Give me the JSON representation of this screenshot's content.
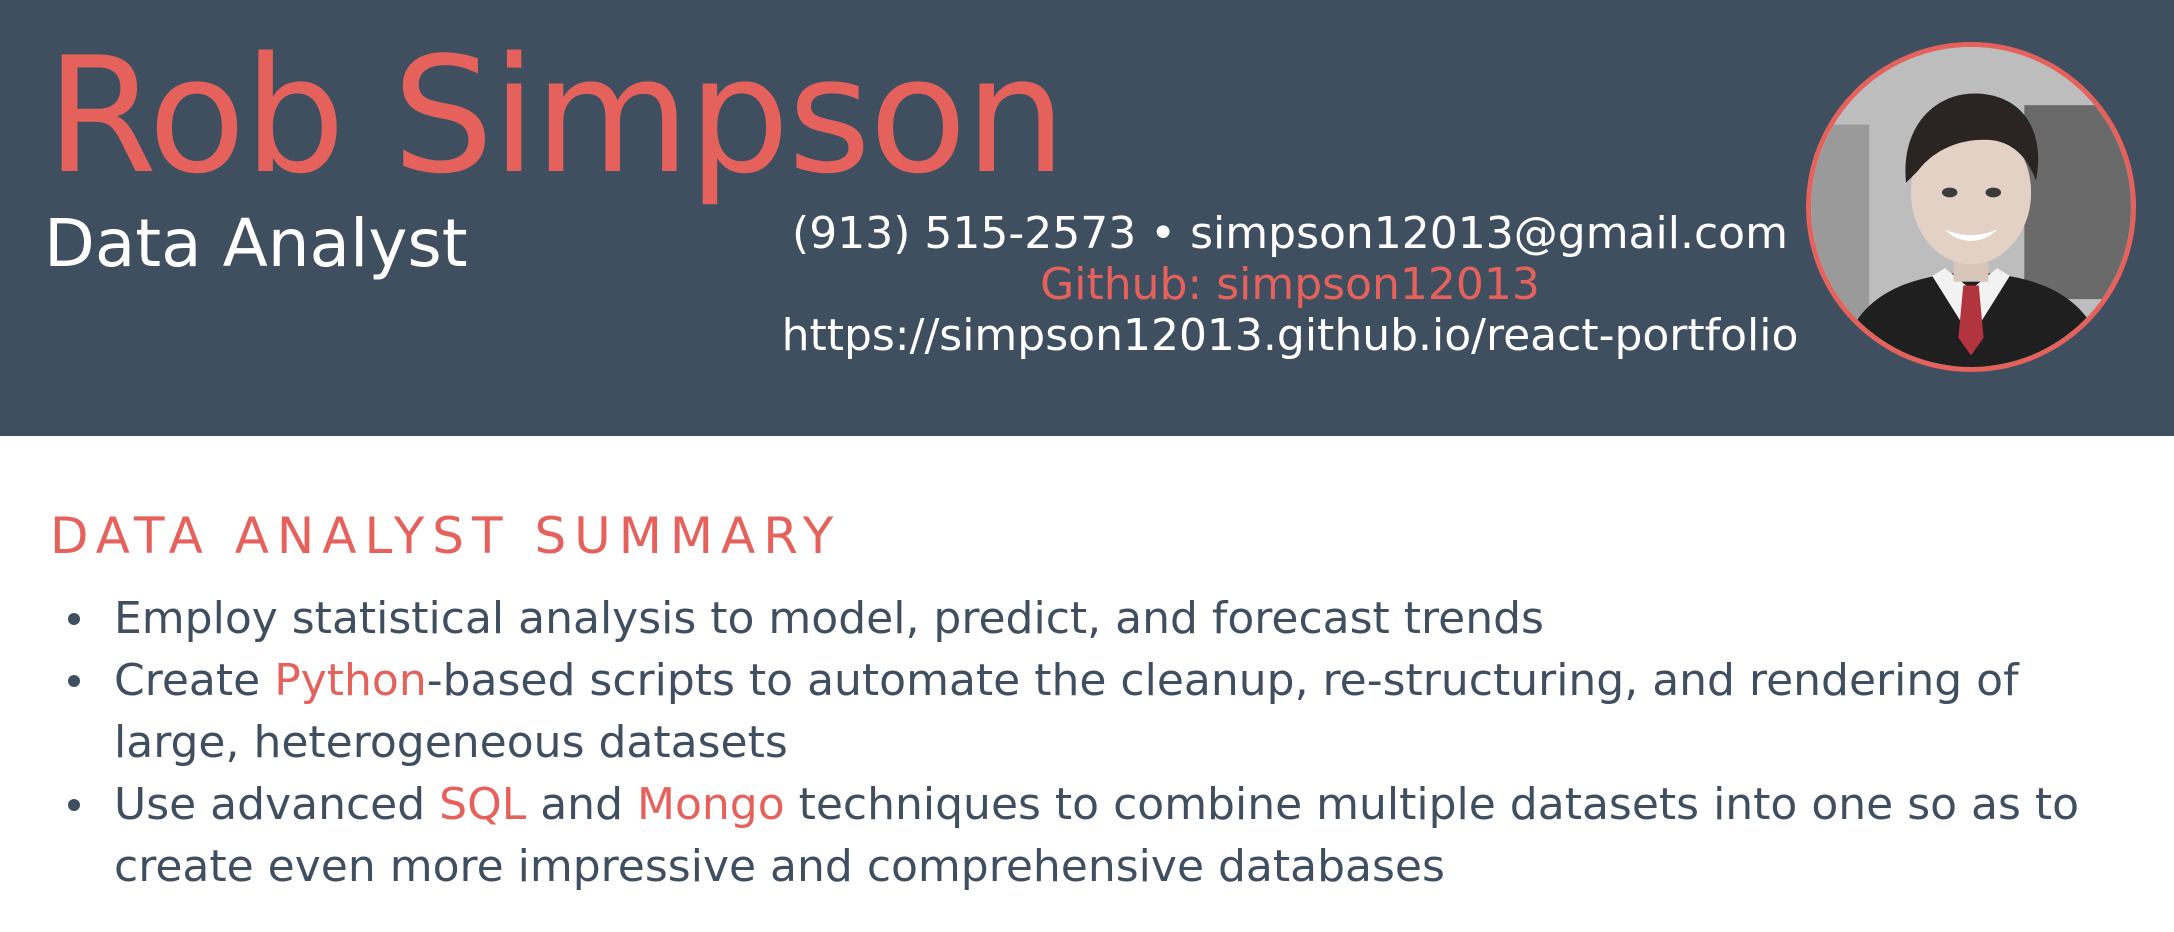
{
  "header": {
    "name": "Rob Simpson",
    "job_title": "Data Analyst",
    "contact": {
      "phone": "(913) 515-2573",
      "separator": " • ",
      "email": "simpson12013@gmail.com",
      "github": "Github: simpson12013",
      "portfolio_url": "https://simpson12013.github.io/react-portfolio"
    }
  },
  "summary": {
    "title": "DATA ANALYST SUMMARY",
    "items": [
      {
        "text": "Employ statistical analysis to model, predict, and forecast trends"
      },
      {
        "before": "Create ",
        "highlight": "Python",
        "after": "-based scripts to automate the cleanup, re-structuring, and rendering of large, heterogeneous datasets"
      },
      {
        "before": "Use advanced ",
        "highlight1": "SQL",
        "middle": " and ",
        "highlight2": "Mongo",
        "after": " techniques to combine multiple datasets into one so as to create even more impressive and comprehensive databases"
      }
    ]
  },
  "colors": {
    "header_background": "#404f5f",
    "accent": "#e5625c",
    "body_text": "#404f5f",
    "header_text": "#ffffff"
  },
  "icons": {
    "profile_photo": "profile-photo"
  }
}
